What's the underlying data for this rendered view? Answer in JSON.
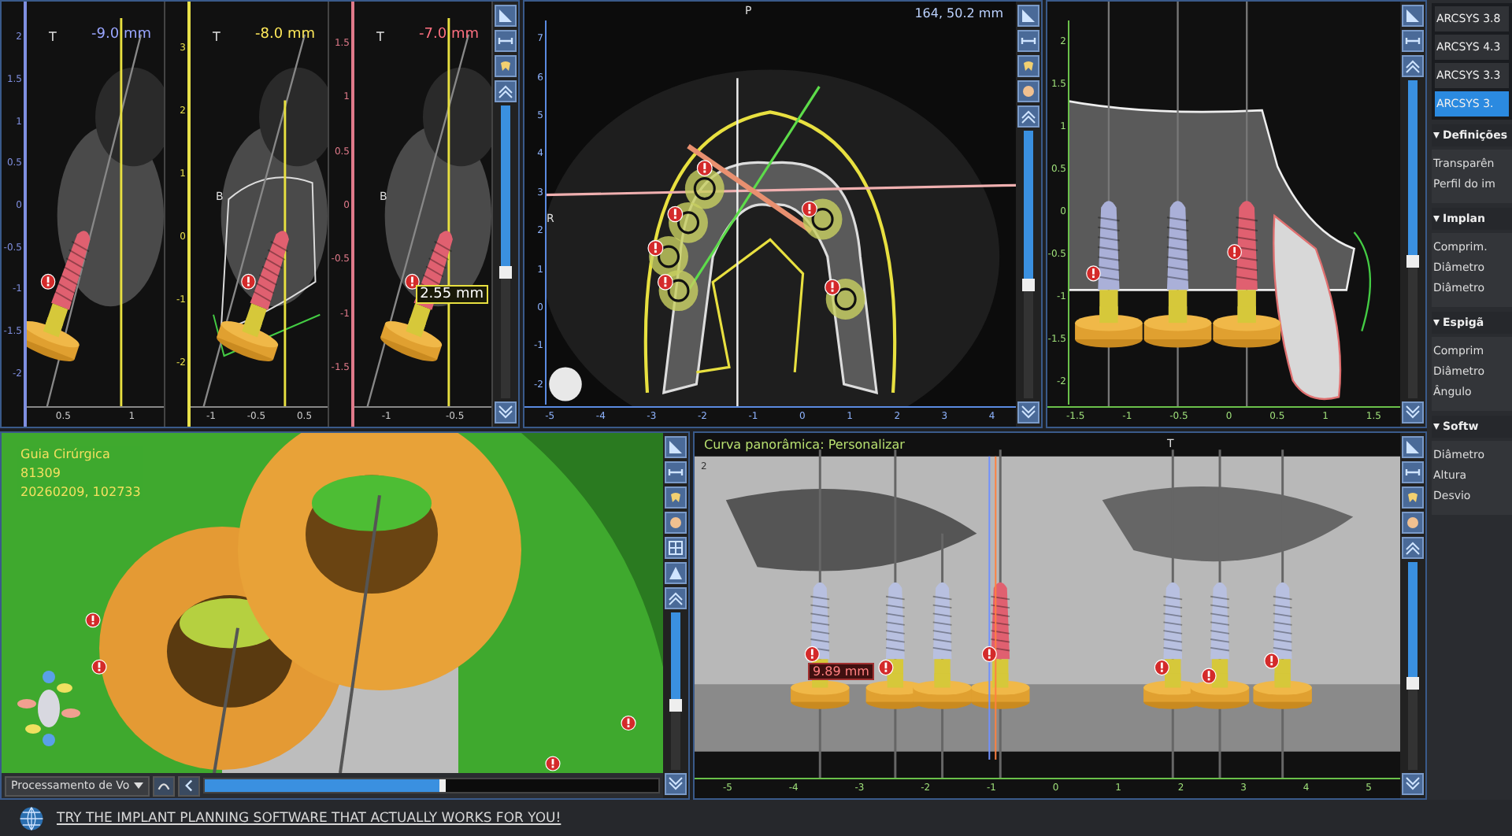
{
  "cross_sections": [
    {
      "top_label": "T",
      "offset": "-9.0 mm",
      "color": "#7f8fe0",
      "y_ticks": [
        "2",
        "1.5",
        "1",
        "0.5",
        "0",
        "-0.5",
        "-1",
        "-1.5",
        "-2"
      ],
      "x_ticks": [
        "0.5",
        "1"
      ]
    },
    {
      "top_label": "T",
      "offset": "-8.0 mm",
      "side_label": "B",
      "color": "#e8e04a",
      "y_ticks": [
        "3",
        "2",
        "1",
        "0",
        "-1",
        "-2"
      ],
      "x_ticks": [
        "-1",
        "-0.5",
        "0.5"
      ]
    },
    {
      "top_label": "T",
      "offset": "-7.0 mm",
      "side_label": "B",
      "measurement": "2.55 mm",
      "color": "#e07a8a",
      "y_ticks": [
        "1.5",
        "1",
        "0.5",
        "0",
        "-0.5",
        "-1",
        "-1.5"
      ],
      "x_ticks": [
        "-1",
        "-0.5"
      ]
    }
  ],
  "axial": {
    "coords": "164, 50.2 mm",
    "top_label": "P",
    "side_label": "R",
    "y_ticks": [
      "7",
      "6",
      "5",
      "4",
      "3",
      "2",
      "1",
      "0",
      "-1",
      "-2"
    ],
    "x_ticks": [
      "-5",
      "-4",
      "-3",
      "-2",
      "-1",
      "0",
      "1",
      "2",
      "3",
      "4"
    ]
  },
  "sagittal": {
    "y_ticks": [
      "2",
      "1.5",
      "1",
      "0.5",
      "0",
      "-0.5",
      "-1",
      "-1.5",
      "-2"
    ],
    "x_ticks": [
      "-1.5",
      "-1",
      "-0.5",
      "0",
      "0.5",
      "1",
      "1.5"
    ]
  },
  "view_3d": {
    "info_lines": [
      "Guia Cirúrgica",
      "81309",
      "20260209, 102733"
    ],
    "render_mode": "Processamento de Vo",
    "slider": {
      "level": 0.53
    }
  },
  "panoramic": {
    "title": "Curva panorâmica: Personalizar",
    "top_label": "T",
    "y_tick": "2",
    "measurement": "9.89 mm",
    "x_ticks": [
      "-5",
      "-4",
      "-3",
      "-2",
      "-1",
      "0",
      "1",
      "2",
      "3",
      "4",
      "5"
    ]
  },
  "sidebar": {
    "implants": [
      {
        "label": "ARCSYS 3.8",
        "selected": false
      },
      {
        "label": "ARCSYS 4.3",
        "selected": false
      },
      {
        "label": "ARCSYS 3.3",
        "selected": false
      },
      {
        "label": "ARCSYS 3.",
        "selected": true
      }
    ],
    "sections": [
      {
        "title": "Definições",
        "expanded": true,
        "fields": [
          "Transparên",
          "Perfil do im"
        ]
      },
      {
        "title": "Implan",
        "expanded": true,
        "fields": [
          "Comprim.",
          "Diâmetro",
          "Diâmetro"
        ]
      },
      {
        "title": "Espigã",
        "expanded": true,
        "fields": [
          "Comprim",
          "Diâmetro",
          "Ângulo"
        ]
      },
      {
        "title": "Softw",
        "expanded": true,
        "fields": [
          "Diâmetro",
          "Altura",
          "Desvio"
        ]
      }
    ]
  },
  "footer": {
    "link": "TRY THE IMPLANT PLANNING SOFTWARE THAT ACTUALLY WORKS FOR YOU!"
  }
}
